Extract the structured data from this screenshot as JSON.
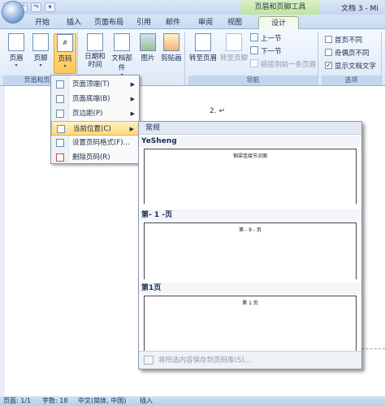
{
  "title_bar": {
    "contextual_title": "页眉和页脚工具",
    "doc_title": "文档 3 - Mi",
    "qat": [
      "save-icon",
      "undo-icon",
      "redo-icon",
      "customize-icon"
    ]
  },
  "tabs": [
    {
      "label": "开始"
    },
    {
      "label": "插入"
    },
    {
      "label": "页面布局"
    },
    {
      "label": "引用"
    },
    {
      "label": "邮件"
    },
    {
      "label": "审阅"
    },
    {
      "label": "视图"
    },
    {
      "label": "设计",
      "active": true
    }
  ],
  "ribbon": {
    "group1": {
      "label": "页眉和页脚",
      "buttons": [
        "页眉",
        "页脚",
        "页码"
      ]
    },
    "group2": {
      "buttons": [
        "日期和\n时间",
        "文档部件",
        "图片",
        "剪贴画"
      ]
    },
    "group_nav": {
      "label": "导航",
      "goto_header": "转至页眉",
      "goto_footer": "转至页脚",
      "prev": "上一节",
      "next": "下一节",
      "link_prev": "链接到前一条页眉"
    },
    "group_options": {
      "label": "选项",
      "first_page": "首页不同",
      "odd_even": "奇偶页不同",
      "show_text": "显示文档文字"
    }
  },
  "document": {
    "text": "2.  ↵"
  },
  "menu": {
    "items": [
      {
        "label": "页面顶端(T)",
        "arrow": "▶"
      },
      {
        "label": "页面底端(B)",
        "arrow": "▶"
      },
      {
        "label": "页边距(P)",
        "arrow": "▶"
      },
      {
        "label": "当前位置(C)",
        "arrow": "▶"
      },
      {
        "label": "设置页码格式(F)..."
      },
      {
        "label": "删除页码(R)"
      }
    ]
  },
  "gallery": {
    "header": "常规",
    "sections": [
      {
        "label": "YeSheng",
        "caption": "钢梁连接节点图"
      },
      {
        "label": "第- 1 -页",
        "caption": "第 - 9 - 页"
      },
      {
        "label": "第1页",
        "caption": "第 1 页"
      }
    ],
    "footer": "将所选内容保存到页码库(S)..."
  },
  "status": {
    "page": "页面: 1/1",
    "words": "字数: 18",
    "lang": "中文(简体, 中国)",
    "mode": "插入"
  }
}
